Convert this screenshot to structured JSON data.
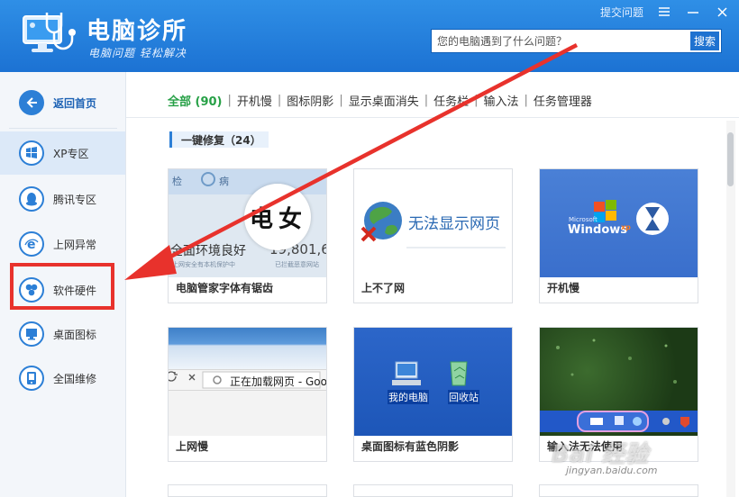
{
  "app": {
    "title": "电脑诊所",
    "slogan": "电脑问题 轻松解决",
    "top_links": {
      "submit_question": "提交问题"
    }
  },
  "search": {
    "placeholder": "您的电脑遇到了什么问题？",
    "button_label": "搜索"
  },
  "sidebar": {
    "back_label": "返回首页",
    "items": [
      {
        "label": "XP专区",
        "icon": "windows-xp-icon",
        "active": true
      },
      {
        "label": "腾讯专区",
        "icon": "qq-penguin-icon"
      },
      {
        "label": "上网异常",
        "icon": "ie-browser-icon"
      },
      {
        "label": "软件硬件",
        "icon": "software-hardware-icon"
      },
      {
        "label": "桌面图标",
        "icon": "monitor-icon"
      },
      {
        "label": "全国维修",
        "icon": "phone-icon"
      }
    ]
  },
  "tabs": [
    {
      "label": "全部 (90)",
      "active": true
    },
    {
      "label": "开机慢"
    },
    {
      "label": "图标阴影"
    },
    {
      "label": "显示桌面消失"
    },
    {
      "label": "任务栏"
    },
    {
      "label": "输入法"
    },
    {
      "label": "任务管理器"
    }
  ],
  "section": {
    "title": "一键修复（24）"
  },
  "cards": [
    {
      "title": "电脑管家字体有锯齿",
      "thumb": {
        "t1": "检",
        "t2": "病",
        "t3": "全面环境良好",
        "t4": "19,801,6",
        "t5": "上网安全有本机保护中",
        "t6": "已拦截恶意网站"
      }
    },
    {
      "title": "上不了网",
      "thumb": {
        "text": "无法显示网页"
      }
    },
    {
      "title": "开机慢",
      "thumb": {
        "brand": "Microsoft",
        "text": "Windows",
        "sup": "xp"
      }
    },
    {
      "title": "上网慢",
      "thumb": {
        "text": "正在加载网页 - Goo"
      }
    },
    {
      "title": "桌面图标有蓝色阴影",
      "thumb": {
        "icon1": "我的电脑",
        "icon2": "回收站"
      }
    },
    {
      "title": "输入法无法使用",
      "thumb": {}
    }
  ],
  "watermark": {
    "main": "Bai 经验",
    "sub": "jingyan.baidu.com"
  },
  "colors": {
    "header": "#1f78d8",
    "accent_green": "#26a046",
    "highlight_red": "#e8322c"
  }
}
